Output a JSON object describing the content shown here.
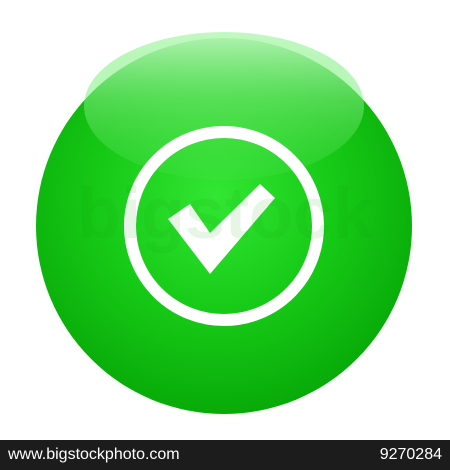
{
  "icon": {
    "name": "check-circle-icon",
    "colors": {
      "green": "#18c818",
      "green_dark": "#0aa00a",
      "green_light": "#8ff08f",
      "glow": "#b9f5b9",
      "mark": "#ffffff"
    }
  },
  "watermark": {
    "text": "bigstock"
  },
  "footer": {
    "site": "www.bigstockphoto.com",
    "image_number": "9270284"
  }
}
